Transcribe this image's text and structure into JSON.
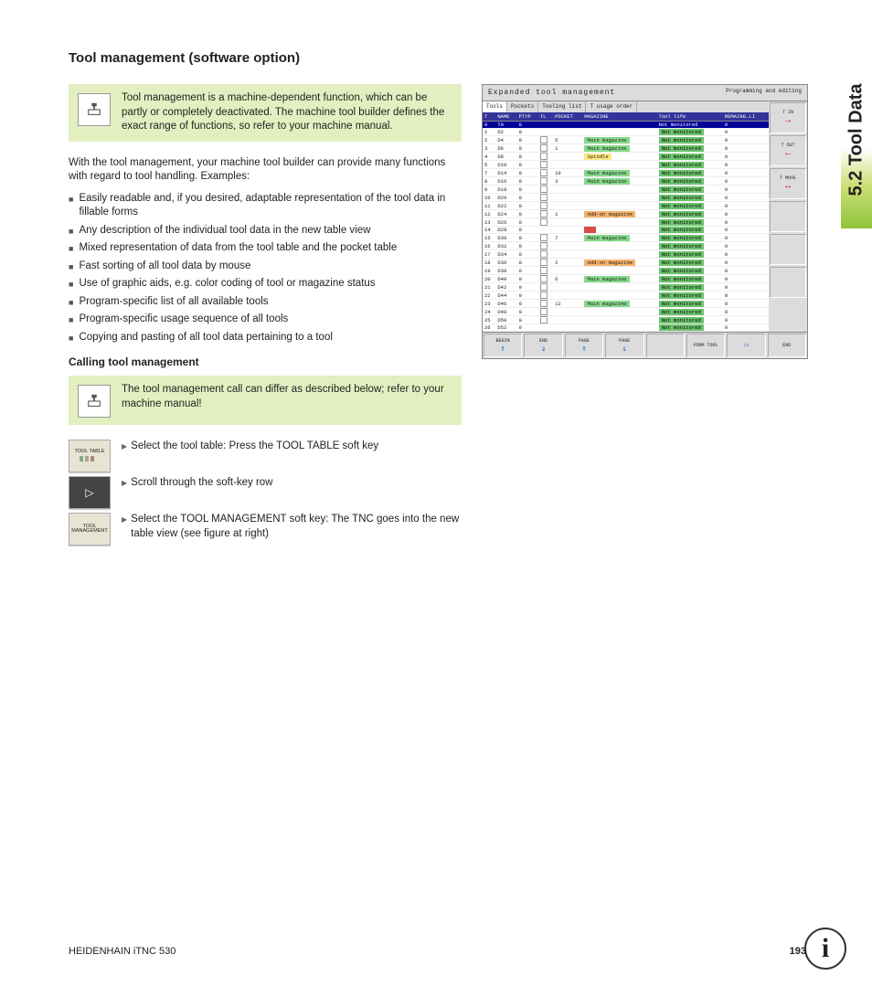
{
  "heading": "Tool management (software option)",
  "note1": "Tool management is a machine-dependent function, which can be partly or completely deactivated. The machine tool builder defines the exact range of functions, so refer to your machine manual.",
  "para1": "With the tool management, your machine tool builder can provide many functions with regard to tool handling. Examples:",
  "bullets": [
    "Easily readable and, if you desired, adaptable representation of the tool data in fillable forms",
    "Any description of the individual tool data in the new table view",
    "Mixed representation of data from the tool table and the pocket table",
    "Fast sorting of all tool data by mouse",
    "Use of graphic aids, e.g. color coding of tool or magazine status",
    "Program-specific list of all available tools",
    "Program-specific usage sequence of all tools",
    "Copying and pasting of all tool data pertaining to a tool"
  ],
  "sub_heading": "Calling tool management",
  "note2": "The tool management call can differ as described below; refer to your machine manual!",
  "keys": {
    "tool_table": "TOOL TABLE",
    "tool_mgmt": "TOOL MANAGEMENT",
    "arrow": "▷"
  },
  "steps": [
    "Select the tool table: Press the TOOL TABLE soft key",
    "Scroll through the soft-key row",
    "Select the TOOL MANAGEMENT soft key: The TNC goes into the new table view (see figure at right)"
  ],
  "side_tab": "5.2 Tool Data",
  "footer_left": "HEIDENHAIN iTNC 530",
  "footer_right": "193",
  "screenshot": {
    "title": "Expanded tool management",
    "mode": "Programming and editing",
    "tabs": [
      "Tools",
      "Pockets",
      "Tooling list",
      "T usage order"
    ],
    "headers": [
      "T",
      "NAME",
      "PTYP",
      "TL",
      "POCKET",
      "MAGAZINE",
      "Tool life",
      "REMAING.LI"
    ],
    "rows": [
      {
        "t": "0",
        "n": "T0",
        "p": "0",
        "tl": "",
        "pk": "",
        "mag": "",
        "mc": "",
        "life": "Not monitored",
        "lc": "row-sel",
        "r": "0"
      },
      {
        "t": "1",
        "n": "D2",
        "p": "0",
        "tl": "",
        "pk": "",
        "mag": "",
        "mc": "",
        "life": "Not monitored",
        "lc": "",
        "r": "0"
      },
      {
        "t": "2",
        "n": "D4",
        "p": "0",
        "tl": "y",
        "pk": "5",
        "mag": "Main magazine",
        "mc": "mag-main",
        "life": "Not monitored",
        "lc": "",
        "r": "0"
      },
      {
        "t": "3",
        "n": "D6",
        "p": "0",
        "tl": "y",
        "pk": "1",
        "mag": "Main magazine",
        "mc": "mag-main",
        "life": "Not monitored",
        "lc": "",
        "r": "0"
      },
      {
        "t": "4",
        "n": "D8",
        "p": "0",
        "tl": "y",
        "pk": "",
        "mag": "Spindle",
        "mc": "mag-spindle",
        "life": "Not monitored",
        "lc": "",
        "r": "0"
      },
      {
        "t": "5",
        "n": "D10",
        "p": "0",
        "tl": "y",
        "pk": "",
        "mag": "",
        "mc": "",
        "life": "Not monitored",
        "lc": "",
        "r": "0"
      },
      {
        "t": "7",
        "n": "D14",
        "p": "0",
        "tl": "y",
        "pk": "10",
        "mag": "Main magazine",
        "mc": "mag-main",
        "life": "Not monitored",
        "lc": "",
        "r": "0"
      },
      {
        "t": "8",
        "n": "D16",
        "p": "0",
        "tl": "y",
        "pk": "3",
        "mag": "Main magazine",
        "mc": "mag-main",
        "life": "Not monitored",
        "lc": "",
        "r": "0"
      },
      {
        "t": "9",
        "n": "D18",
        "p": "0",
        "tl": "y",
        "pk": "",
        "mag": "",
        "mc": "",
        "life": "Not monitored",
        "lc": "",
        "r": "0"
      },
      {
        "t": "10",
        "n": "D20",
        "p": "0",
        "tl": "y",
        "pk": "",
        "mag": "",
        "mc": "",
        "life": "Not monitored",
        "lc": "",
        "r": "0"
      },
      {
        "t": "11",
        "n": "D22",
        "p": "0",
        "tl": "y",
        "pk": "",
        "mag": "",
        "mc": "",
        "life": "Not monitored",
        "lc": "",
        "r": "0"
      },
      {
        "t": "12",
        "n": "D24",
        "p": "0",
        "tl": "y",
        "pk": "1",
        "mag": "Add-on magazine",
        "mc": "mag-addon",
        "life": "Not monitored",
        "lc": "",
        "r": "0"
      },
      {
        "t": "13",
        "n": "D26",
        "p": "0",
        "tl": "y",
        "pk": "",
        "mag": "",
        "mc": "",
        "life": "Not monitored",
        "lc": "",
        "r": "0"
      },
      {
        "t": "14",
        "n": "D28",
        "p": "0",
        "tl": "",
        "pk": "",
        "mag": "",
        "mc": "mag-red",
        "life": "Not monitored",
        "lc": "",
        "r": "0"
      },
      {
        "t": "15",
        "n": "D30",
        "p": "0",
        "tl": "y",
        "pk": "7",
        "mag": "Main magazine",
        "mc": "mag-main",
        "life": "Not monitored",
        "lc": "",
        "r": "0"
      },
      {
        "t": "16",
        "n": "D32",
        "p": "0",
        "tl": "y",
        "pk": "",
        "mag": "",
        "mc": "",
        "life": "Not monitored",
        "lc": "",
        "r": "0"
      },
      {
        "t": "17",
        "n": "D34",
        "p": "0",
        "tl": "y",
        "pk": "",
        "mag": "",
        "mc": "",
        "life": "Not monitored",
        "lc": "",
        "r": "0"
      },
      {
        "t": "18",
        "n": "D36",
        "p": "0",
        "tl": "y",
        "pk": "2",
        "mag": "Add-on magazine",
        "mc": "mag-addon",
        "life": "Not monitored",
        "lc": "",
        "r": "0"
      },
      {
        "t": "19",
        "n": "D38",
        "p": "0",
        "tl": "y",
        "pk": "",
        "mag": "",
        "mc": "",
        "life": "Not monitored",
        "lc": "",
        "r": "0"
      },
      {
        "t": "20",
        "n": "D40",
        "p": "0",
        "tl": "y",
        "pk": "6",
        "mag": "Main magazine",
        "mc": "mag-main",
        "life": "Not monitored",
        "lc": "",
        "r": "0"
      },
      {
        "t": "21",
        "n": "D42",
        "p": "0",
        "tl": "y",
        "pk": "",
        "mag": "",
        "mc": "",
        "life": "Not monitored",
        "lc": "",
        "r": "0"
      },
      {
        "t": "22",
        "n": "D44",
        "p": "0",
        "tl": "y",
        "pk": "",
        "mag": "",
        "mc": "",
        "life": "Not monitored",
        "lc": "",
        "r": "0"
      },
      {
        "t": "23",
        "n": "D46",
        "p": "0",
        "tl": "y",
        "pk": "12",
        "mag": "Main magazine",
        "mc": "mag-main",
        "life": "Not monitored",
        "lc": "",
        "r": "0"
      },
      {
        "t": "24",
        "n": "D48",
        "p": "0",
        "tl": "y",
        "pk": "",
        "mag": "",
        "mc": "",
        "life": "Not monitored",
        "lc": "",
        "r": "0"
      },
      {
        "t": "25",
        "n": "D50",
        "p": "0",
        "tl": "y",
        "pk": "",
        "mag": "",
        "mc": "",
        "life": "Not monitored",
        "lc": "",
        "r": "0"
      },
      {
        "t": "26",
        "n": "D52",
        "p": "0",
        "tl": "",
        "pk": "",
        "mag": "",
        "mc": "",
        "life": "Not monitored",
        "lc": "",
        "r": "0"
      }
    ],
    "side_btns": [
      "T IN",
      "T OUT",
      "T MOVE",
      "",
      "",
      ""
    ],
    "softkeys": [
      "BEGIN",
      "END",
      "PAGE",
      "PAGE",
      "",
      "FORM TOOL",
      "",
      "END"
    ]
  }
}
